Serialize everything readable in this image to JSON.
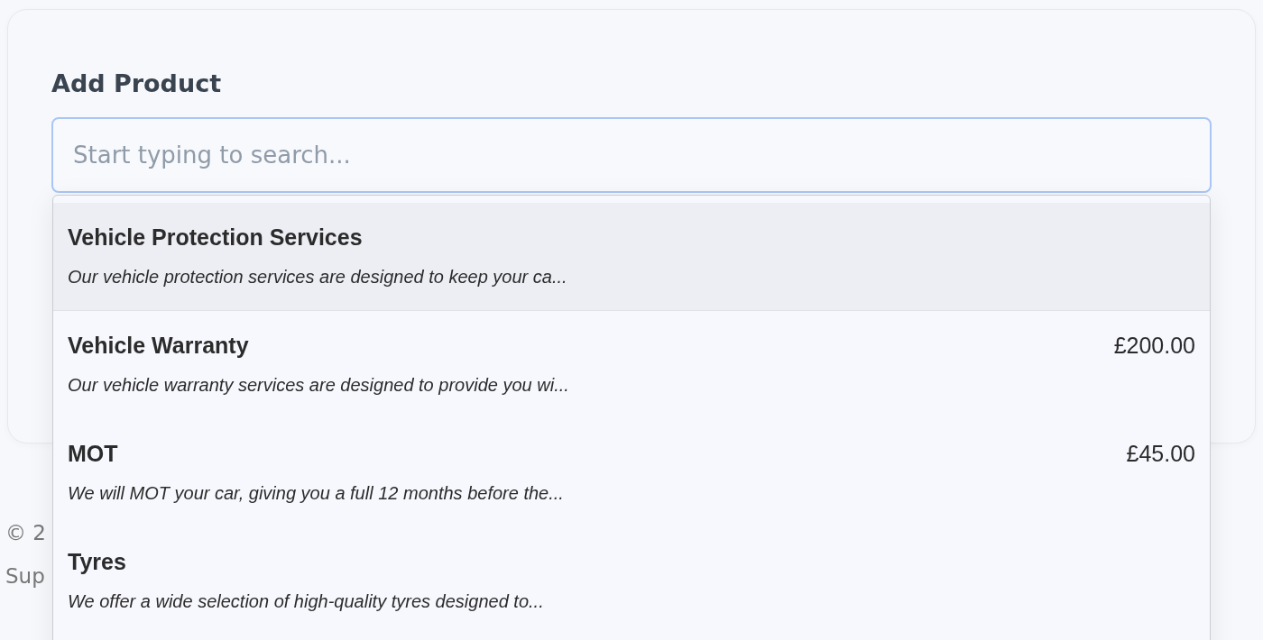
{
  "card": {
    "heading": "Add Product",
    "search": {
      "placeholder": "Start typing to search..."
    }
  },
  "results": [
    {
      "name": "Vehicle Protection Services",
      "description": "Our vehicle protection services are designed to keep your ca...",
      "selected": true
    },
    {
      "name": "Vehicle Warranty",
      "price": "£200.00",
      "description": "Our vehicle warranty services are designed to provide you wi...",
      "selected": false
    },
    {
      "name": "MOT",
      "price": "£45.00",
      "description": "We will MOT your car, giving you a full 12 months before the...",
      "selected": false
    },
    {
      "name": "Tyres",
      "description": "We offer a wide selection of high-quality tyres designed to...",
      "selected": false
    }
  ],
  "footer": {
    "copyright": "© 2",
    "support": "Sup"
  }
}
